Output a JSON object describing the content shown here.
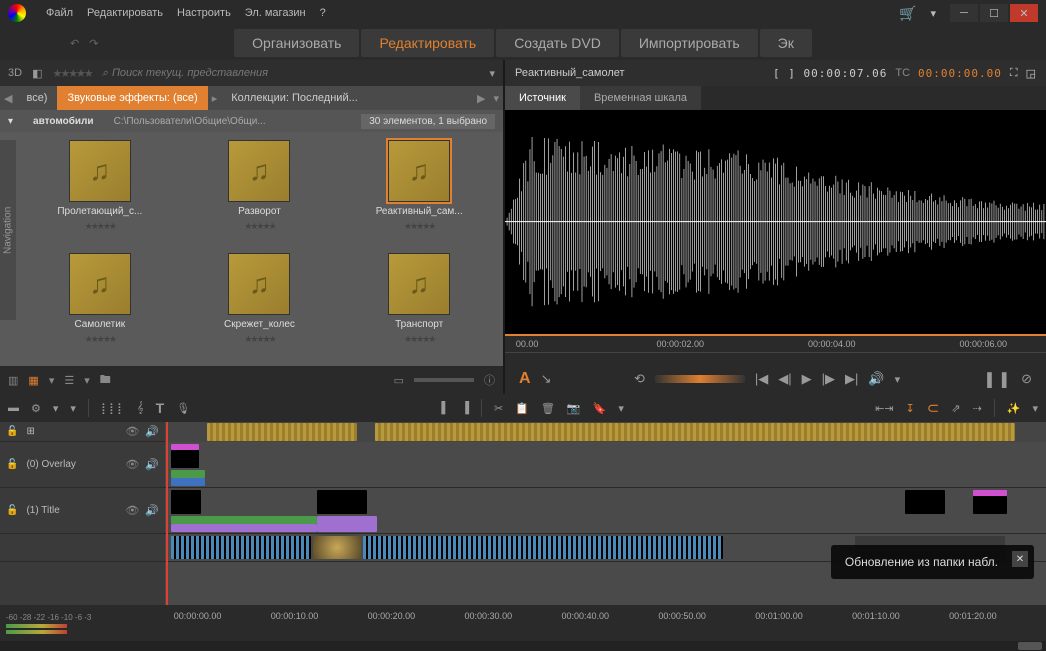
{
  "menu": {
    "file": "Файл",
    "edit": "Редактировать",
    "setup": "Настроить",
    "estore": "Эл. магазин"
  },
  "modes": {
    "organize": "Организовать",
    "edit": "Редактировать",
    "createdvd": "Создать DVD",
    "import": "Импортировать",
    "export": "Эк"
  },
  "library": {
    "mode3d": "3D",
    "search_placeholder": "Поиск текущ. представления",
    "bc_all": "все)",
    "bc_sound": "Звуковые эффекты: (все)",
    "bc_collections": "Коллекции: Последний...",
    "category": "автомобили",
    "path": "C:\\Пользователи\\Общие\\Общи...",
    "count": "30 элементов, 1 выбрано",
    "nav_label": "Navigation",
    "items": [
      {
        "label": "Пролетающий_с..."
      },
      {
        "label": "Разворот"
      },
      {
        "label": "Реактивный_сам...",
        "selected": true
      },
      {
        "label": "Самолетик"
      },
      {
        "label": "Скрежет_колес"
      },
      {
        "label": "Транспорт"
      }
    ]
  },
  "preview": {
    "clip_name": "Реактивный_самолет",
    "tc_in": "[ ] 00:00:07.06",
    "tc_label": "TC",
    "tc_master": "00:00:00.00",
    "tab_source": "Источник",
    "tab_timeline": "Временная шкала",
    "ticks": [
      "00.00",
      "00:00:02.00",
      "00:00:04.00",
      "00:00:06.00"
    ],
    "a_label": "A"
  },
  "timeline": {
    "tracks": [
      {
        "label": "(0) Overlay"
      },
      {
        "label": "(1) Title"
      }
    ],
    "meter_scale": "-60  -28 -22 -16 -10  -6  -3",
    "ruler": [
      "00:00:00.00",
      "00:00:10.00",
      "00:00:20.00",
      "00:00:30.00",
      "00:00:40.00",
      "00:00:50.00",
      "00:01:00.00",
      "00:01:10.00",
      "00:01:20.00"
    ]
  },
  "toast": {
    "message": "Обновление из папки набл."
  }
}
